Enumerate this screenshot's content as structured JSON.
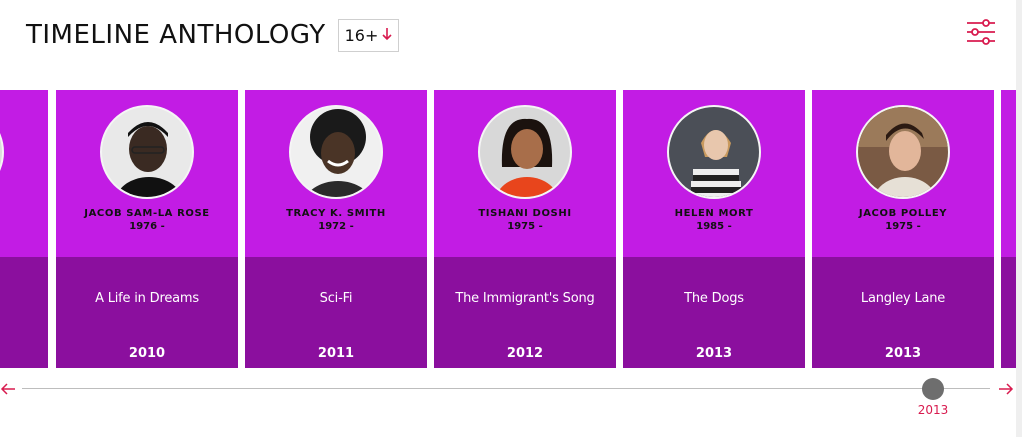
{
  "header": {
    "title": "TIMELINE ANTHOLOGY",
    "age_rating": "16+",
    "sort_icon": "arrow-down-icon",
    "filter_icon": "sliders-icon"
  },
  "colors": {
    "card_top": "#c21ce4",
    "card_bottom": "#8b0f9e",
    "accent": "#d81b4f",
    "thumb": "#6e6e6e"
  },
  "cards": [
    {
      "name": "JACOB SAM-LA ROSE",
      "dates": "1976 -",
      "work": "A Life in Dreams",
      "year": "2010"
    },
    {
      "name": "TRACY K. SMITH",
      "dates": "1972 -",
      "work": "Sci-Fi",
      "year": "2011"
    },
    {
      "name": "TISHANI DOSHI",
      "dates": "1975 -",
      "work": "The Immigrant's Song",
      "year": "2012"
    },
    {
      "name": "HELEN MORT",
      "dates": "1985 -",
      "work": "The Dogs",
      "year": "2013"
    },
    {
      "name": "JACOB POLLEY",
      "dates": "1975 -",
      "work": "Langley Lane",
      "year": "2013"
    }
  ],
  "timeline": {
    "current_year": "2013",
    "prev_icon": "arrow-left-icon",
    "next_icon": "arrow-right-icon"
  }
}
